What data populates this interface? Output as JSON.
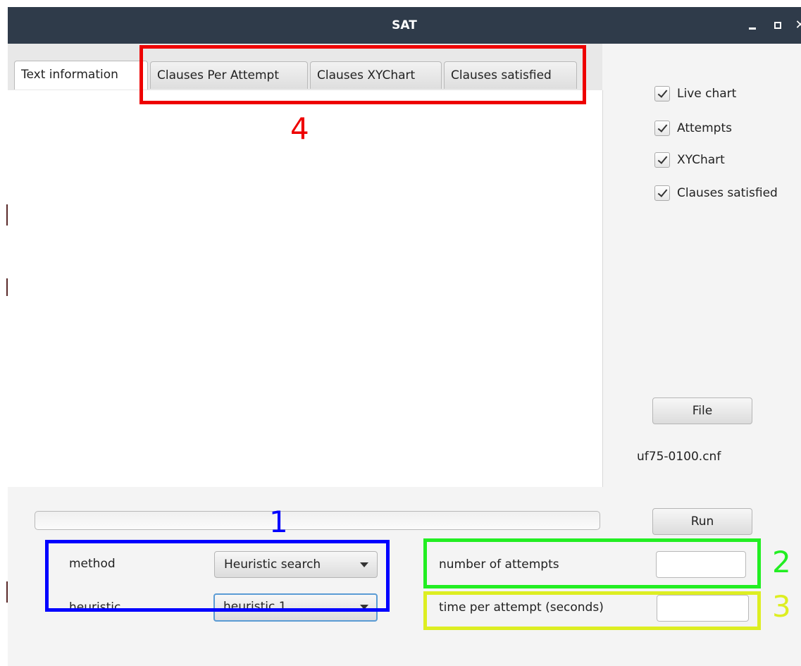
{
  "window": {
    "title": "SAT"
  },
  "tabs": [
    {
      "label": "Text information",
      "active": true
    },
    {
      "label": "Clauses Per Attempt",
      "active": false
    },
    {
      "label": "Clauses XYChart",
      "active": false
    },
    {
      "label": "Clauses satisfied",
      "active": false
    }
  ],
  "options": [
    {
      "label": "Live chart",
      "checked": true
    },
    {
      "label": "Attempts",
      "checked": true
    },
    {
      "label": "XYChart",
      "checked": true
    },
    {
      "label": "Clauses satisfied",
      "checked": true
    }
  ],
  "file": {
    "button_label": "File",
    "selected_file": "uf75-0100.cnf"
  },
  "run": {
    "button_label": "Run",
    "progress": 0
  },
  "method": {
    "label": "method",
    "value": "Heuristic search"
  },
  "heuristic": {
    "label": "heuristic",
    "value": "heuristic 1"
  },
  "attempts": {
    "label": "number of attempts",
    "value": ""
  },
  "time_per_attempt": {
    "label": "time per attempt (seconds)",
    "value": ""
  },
  "annotations": [
    {
      "number": "1",
      "color": "#0000ff"
    },
    {
      "number": "2",
      "color": "#22ee22"
    },
    {
      "number": "3",
      "color": "#ddee22"
    },
    {
      "number": "4",
      "color": "#ee0000"
    }
  ]
}
